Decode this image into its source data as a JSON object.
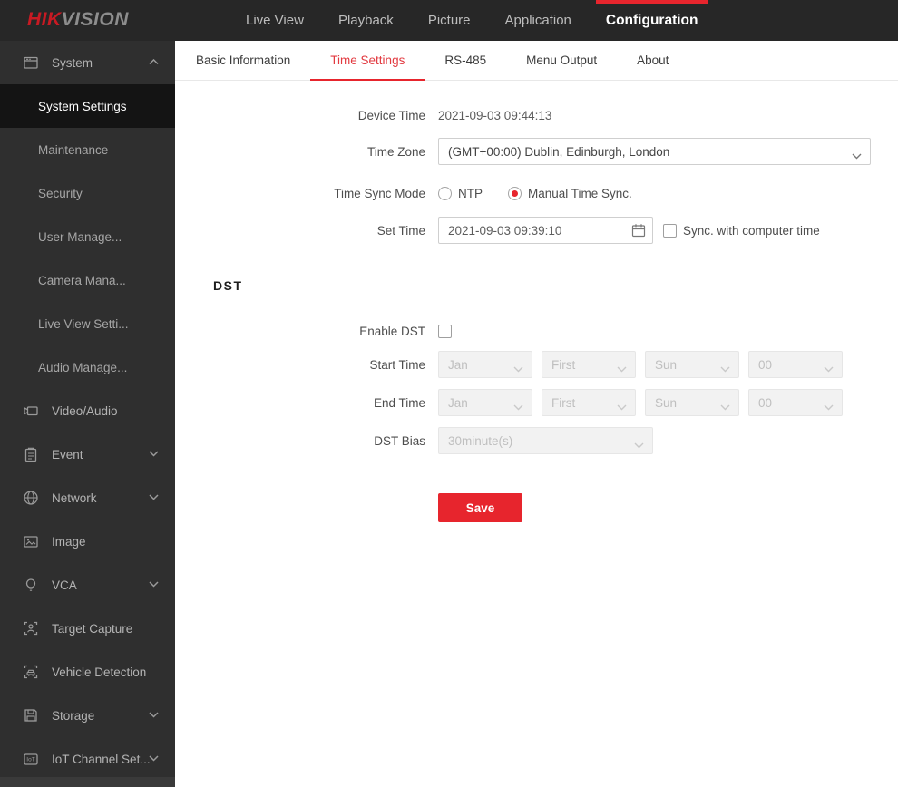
{
  "topbar": {
    "logo": {
      "hik": "HIK",
      "vision": "VISION"
    },
    "nav": [
      {
        "label": "Live View"
      },
      {
        "label": "Playback"
      },
      {
        "label": "Picture"
      },
      {
        "label": "Application"
      },
      {
        "label": "Configuration"
      }
    ]
  },
  "sidebar": {
    "items": [
      {
        "label": "System"
      },
      {
        "label": "System Settings"
      },
      {
        "label": "Maintenance"
      },
      {
        "label": "Security"
      },
      {
        "label": "User Manage..."
      },
      {
        "label": "Camera Mana..."
      },
      {
        "label": "Live View Setti..."
      },
      {
        "label": "Audio Manage..."
      },
      {
        "label": "Video/Audio"
      },
      {
        "label": "Event"
      },
      {
        "label": "Network"
      },
      {
        "label": "Image"
      },
      {
        "label": "VCA"
      },
      {
        "label": "Target Capture"
      },
      {
        "label": "Vehicle Detection"
      },
      {
        "label": "Storage"
      },
      {
        "label": "IoT Channel Set..."
      }
    ]
  },
  "tabs": [
    {
      "label": "Basic Information"
    },
    {
      "label": "Time Settings"
    },
    {
      "label": "RS-485"
    },
    {
      "label": "Menu Output"
    },
    {
      "label": "About"
    }
  ],
  "form": {
    "device_time": {
      "label": "Device Time",
      "value": "2021-09-03 09:44:13"
    },
    "time_zone": {
      "label": "Time Zone",
      "value": "(GMT+00:00) Dublin, Edinburgh, London"
    },
    "time_sync_mode": {
      "label": "Time Sync Mode",
      "options": [
        {
          "label": "NTP",
          "selected": false
        },
        {
          "label": "Manual Time Sync.",
          "selected": true
        }
      ]
    },
    "set_time": {
      "label": "Set Time",
      "value": "2021-09-03 09:39:10",
      "sync_checkbox_label": "Sync. with computer time",
      "checked": false
    },
    "dst": {
      "section_title": "DST",
      "enable": {
        "label": "Enable DST",
        "checked": false
      },
      "start_time": {
        "label": "Start Time",
        "values": [
          "Jan",
          "First",
          "Sun",
          "00"
        ]
      },
      "end_time": {
        "label": "End Time",
        "values": [
          "Jan",
          "First",
          "Sun",
          "00"
        ]
      },
      "dst_bias": {
        "label": "DST Bias",
        "value": "30minute(s)"
      }
    },
    "save_label": "Save"
  },
  "colors": {
    "accent_red": "#e7252d",
    "topbar_bg": "#272727",
    "sidebar_bg": "#2f2f2f",
    "sidebar_active_bg": "#141414",
    "disabled_field_bg": "#f2f2f2"
  }
}
